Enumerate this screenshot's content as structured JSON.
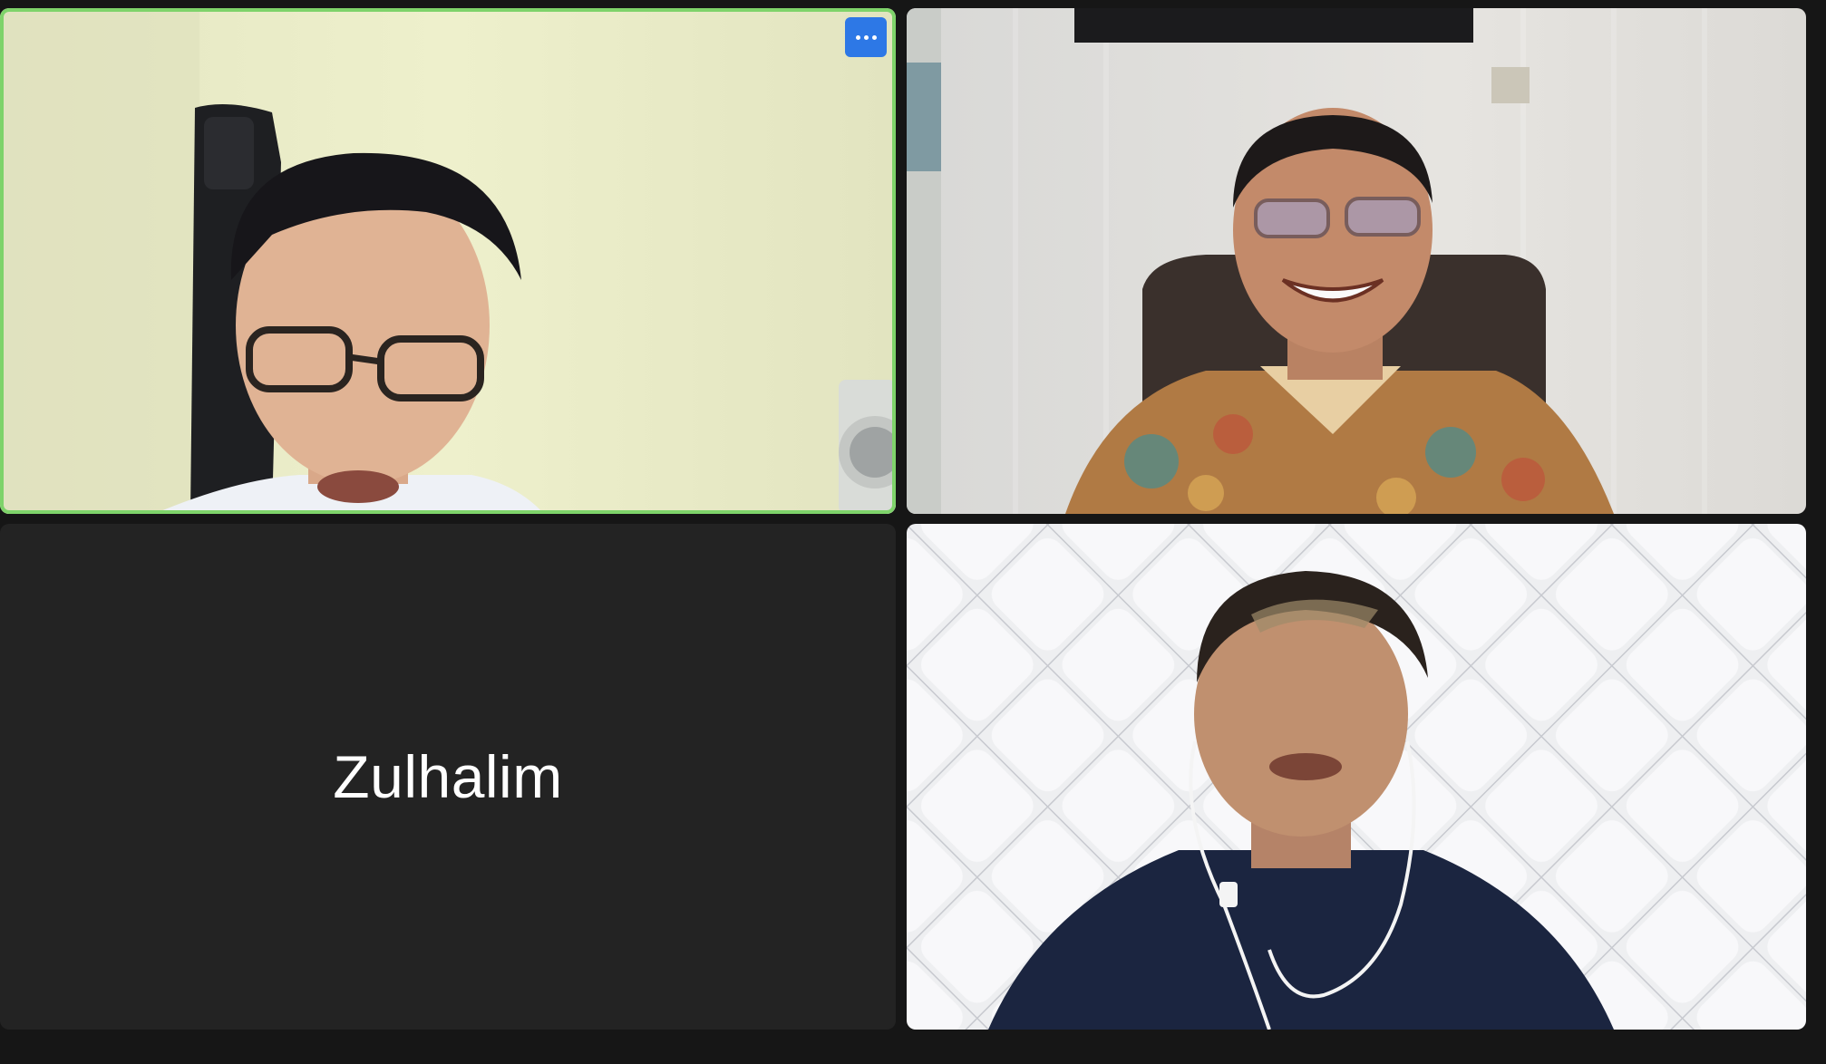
{
  "meeting": {
    "participants": [
      {
        "id": "p1",
        "video_on": true,
        "active_speaker": true
      },
      {
        "id": "p2",
        "video_on": true,
        "active_speaker": false
      },
      {
        "id": "p3",
        "video_on": false,
        "active_speaker": false,
        "name": "Zulhalim"
      },
      {
        "id": "p4",
        "video_on": true,
        "active_speaker": false
      }
    ],
    "controls": {
      "more_options_icon": "ellipsis-icon"
    }
  },
  "colors": {
    "background": "#161616",
    "tile_off": "#232323",
    "active_speaker_border": "#7ed36a",
    "more_button": "#2d78e6"
  }
}
